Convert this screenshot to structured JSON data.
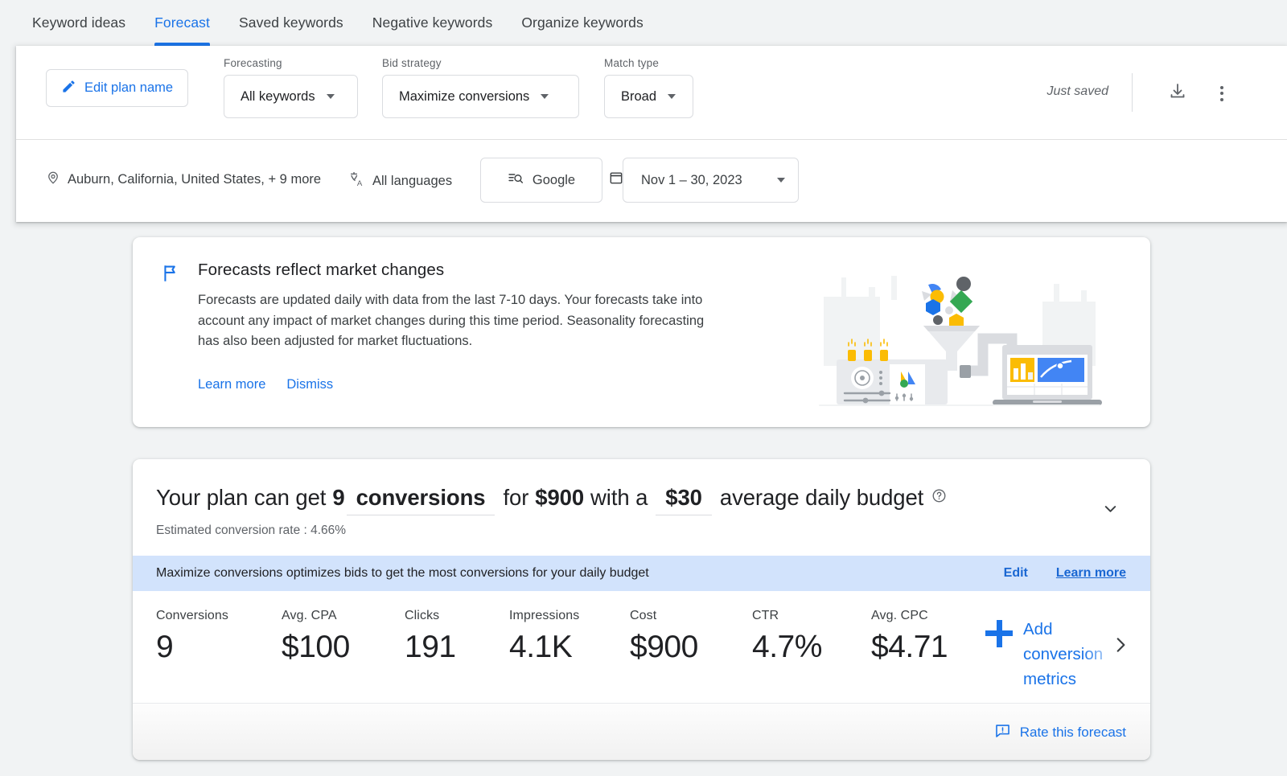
{
  "tabs": [
    {
      "label": "Keyword ideas",
      "active": false
    },
    {
      "label": "Forecast",
      "active": true
    },
    {
      "label": "Saved keywords",
      "active": false
    },
    {
      "label": "Negative keywords",
      "active": false
    },
    {
      "label": "Organize keywords",
      "active": false
    }
  ],
  "toolbar": {
    "edit_plan_label": "Edit plan name",
    "edit_icon": "pencil-icon",
    "forecasting": {
      "label": "Forecasting",
      "value": "All keywords"
    },
    "bid_strategy": {
      "label": "Bid strategy",
      "value": "Maximize conversions"
    },
    "match_type": {
      "label": "Match type",
      "value": "Broad"
    },
    "save_status": "Just saved",
    "download_icon": "download-icon",
    "more_icon": "more-vertical-icon"
  },
  "filters": {
    "location": "Auburn, California, United States, + 9 more",
    "location_icon": "location-pin-icon",
    "language": "All languages",
    "language_icon": "translate-icon",
    "network": "Google",
    "network_icon": "search-list-icon",
    "calendar_icon": "calendar-icon",
    "date_range": "Nov 1 – 30, 2023"
  },
  "notice": {
    "flag_icon": "flag-icon",
    "title": "Forecasts reflect market changes",
    "body": "Forecasts are updated daily with data from the last 7-10 days. Your forecasts take into account any impact of market changes during this time period. Seasonality forecasting has also been adjusted for market fluctuations.",
    "learn_more": "Learn more",
    "dismiss": "Dismiss",
    "illustration": "forecast-machine-illustration"
  },
  "forecast": {
    "headline": {
      "prefix": "Your plan can get",
      "conversions_count": "9",
      "conversions_unit": "conversions",
      "for_word": "for",
      "cost": "$900",
      "with_a": "with a",
      "budget": "$30",
      "suffix": "average daily budget",
      "help_icon": "help-circle-icon"
    },
    "estimated_rate": "Estimated conversion rate : 4.66%",
    "collapse_icon": "chevron-down-icon",
    "banner": {
      "text": "Maximize conversions optimizes bids to get the most conversions for your daily budget",
      "edit": "Edit",
      "learn_more": "Learn more"
    },
    "metrics": [
      {
        "label": "Conversions",
        "value": "9"
      },
      {
        "label": "Avg. CPA",
        "value": "$100"
      },
      {
        "label": "Clicks",
        "value": "191"
      },
      {
        "label": "Impressions",
        "value": "4.1K"
      },
      {
        "label": "Cost",
        "value": "$900"
      },
      {
        "label": "CTR",
        "value": "4.7%"
      },
      {
        "label": "Avg. CPC",
        "value": "$4.71"
      }
    ],
    "add_metrics_label": "Add conversion metrics",
    "add_icon": "plus-icon",
    "scroll_right_icon": "chevron-right-icon",
    "rate_label": "Rate this forecast",
    "rate_icon": "feedback-icon"
  },
  "colors": {
    "accent": "#1a73e8",
    "banner_bg": "#d2e3fc",
    "page_bg": "#f1f3f4",
    "text_primary": "#202124",
    "text_secondary": "#5f6368"
  }
}
